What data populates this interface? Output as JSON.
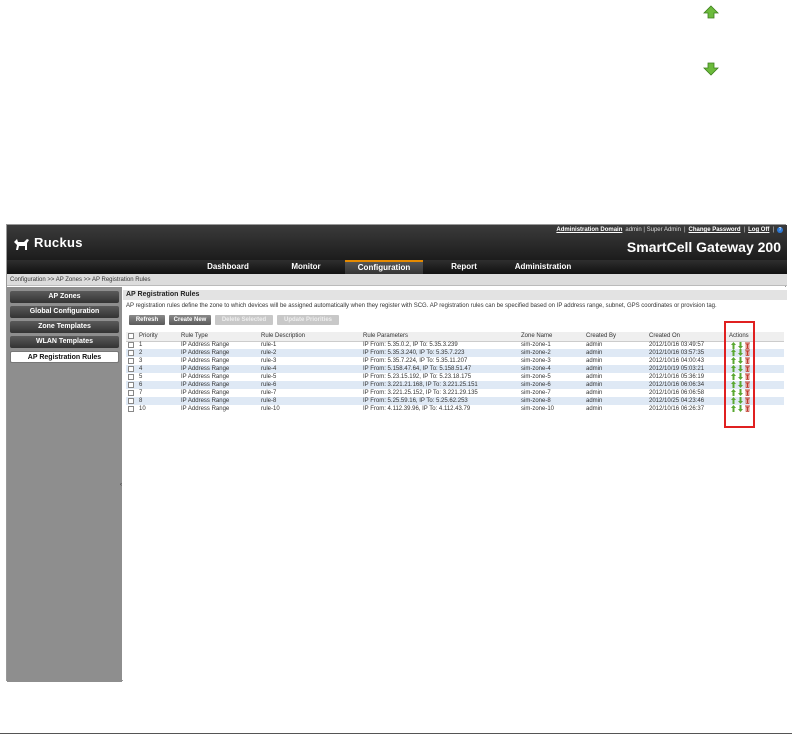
{
  "legend": {
    "up_icon": "green-up-arrow-icon",
    "down_icon": "green-down-arrow-icon"
  },
  "header": {
    "logo_text": "Ruckus",
    "links": {
      "admin_domain": "Administration Domain",
      "user": "admin | Super Admin",
      "change_password": "Change Password",
      "log_off": "Log Off",
      "help": "?"
    },
    "product_name": "SmartCell Gateway 200"
  },
  "nav": {
    "items": [
      "Dashboard",
      "Monitor",
      "Configuration",
      "Report",
      "Administration"
    ],
    "active": "Configuration"
  },
  "breadcrumb": "Configuration  >>  AP Zones  >>  AP Registration Rules",
  "sidebar": {
    "items": [
      "AP Zones",
      "Global Configuration",
      "Zone Templates",
      "WLAN Templates",
      "AP Registration Rules"
    ],
    "active": "AP Registration Rules"
  },
  "panel": {
    "title": "AP Registration Rules",
    "description": "AP registration rules define the zone to which devices will be assigned automatically when they register with SCG. AP registration rules can be specified based on IP address range, subnet, GPS coordinates or provision tag.",
    "buttons": {
      "refresh": "Refresh",
      "create_new": "Create New",
      "delete_selected": "Delete Selected",
      "update_priorities": "Update Priorities"
    }
  },
  "table": {
    "columns": [
      "Priority",
      "Rule Type",
      "Rule Description",
      "Rule Parameters",
      "Zone Name",
      "Created By",
      "Created On",
      "Actions"
    ],
    "rows": [
      {
        "priority": "1",
        "type": "IP Address Range",
        "desc": "rule-1",
        "params": "IP From: 5.35.0.2, IP To: 5.35.3.239",
        "zone": "sim-zone-1",
        "by": "admin",
        "on": "2012/10/16 03:49:57"
      },
      {
        "priority": "2",
        "type": "IP Address Range",
        "desc": "rule-2",
        "params": "IP From: 5.35.3.240, IP To: 5.35.7.223",
        "zone": "sim-zone-2",
        "by": "admin",
        "on": "2012/10/16 03:57:35"
      },
      {
        "priority": "3",
        "type": "IP Address Range",
        "desc": "rule-3",
        "params": "IP From: 5.35.7.224, IP To: 5.35.11.207",
        "zone": "sim-zone-3",
        "by": "admin",
        "on": "2012/10/16 04:00:43"
      },
      {
        "priority": "4",
        "type": "IP Address Range",
        "desc": "rule-4",
        "params": "IP From: 5.158.47.64, IP To: 5.158.51.47",
        "zone": "sim-zone-4",
        "by": "admin",
        "on": "2012/10/19 05:03:21"
      },
      {
        "priority": "5",
        "type": "IP Address Range",
        "desc": "rule-5",
        "params": "IP From: 5.23.15.192, IP To: 5.23.18.175",
        "zone": "sim-zone-5",
        "by": "admin",
        "on": "2012/10/16 05:36:19"
      },
      {
        "priority": "6",
        "type": "IP Address Range",
        "desc": "rule-6",
        "params": "IP From: 3.221.21.168, IP To: 3.221.25.151",
        "zone": "sim-zone-6",
        "by": "admin",
        "on": "2012/10/16 06:06:34"
      },
      {
        "priority": "7",
        "type": "IP Address Range",
        "desc": "rule-7",
        "params": "IP From: 3.221.25.152, IP To: 3.221.29.135",
        "zone": "sim-zone-7",
        "by": "admin",
        "on": "2012/10/16 06:06:58"
      },
      {
        "priority": "8",
        "type": "IP Address Range",
        "desc": "rule-8",
        "params": "IP From: 5.25.59.16, IP To: 5.25.62.253",
        "zone": "sim-zone-8",
        "by": "admin",
        "on": "2012/10/25 04:23:46"
      },
      {
        "priority": "10",
        "type": "IP Address Range",
        "desc": "rule-10",
        "params": "IP From: 4.112.39.96, IP To: 4.112.43.79",
        "zone": "sim-zone-10",
        "by": "admin",
        "on": "2012/10/16 06:26:37"
      }
    ]
  },
  "colors": {
    "accent": "#e58a00",
    "highlight_box": "#e02020",
    "arrow_green": "#5aa832",
    "delete_red": "#c0392b"
  }
}
